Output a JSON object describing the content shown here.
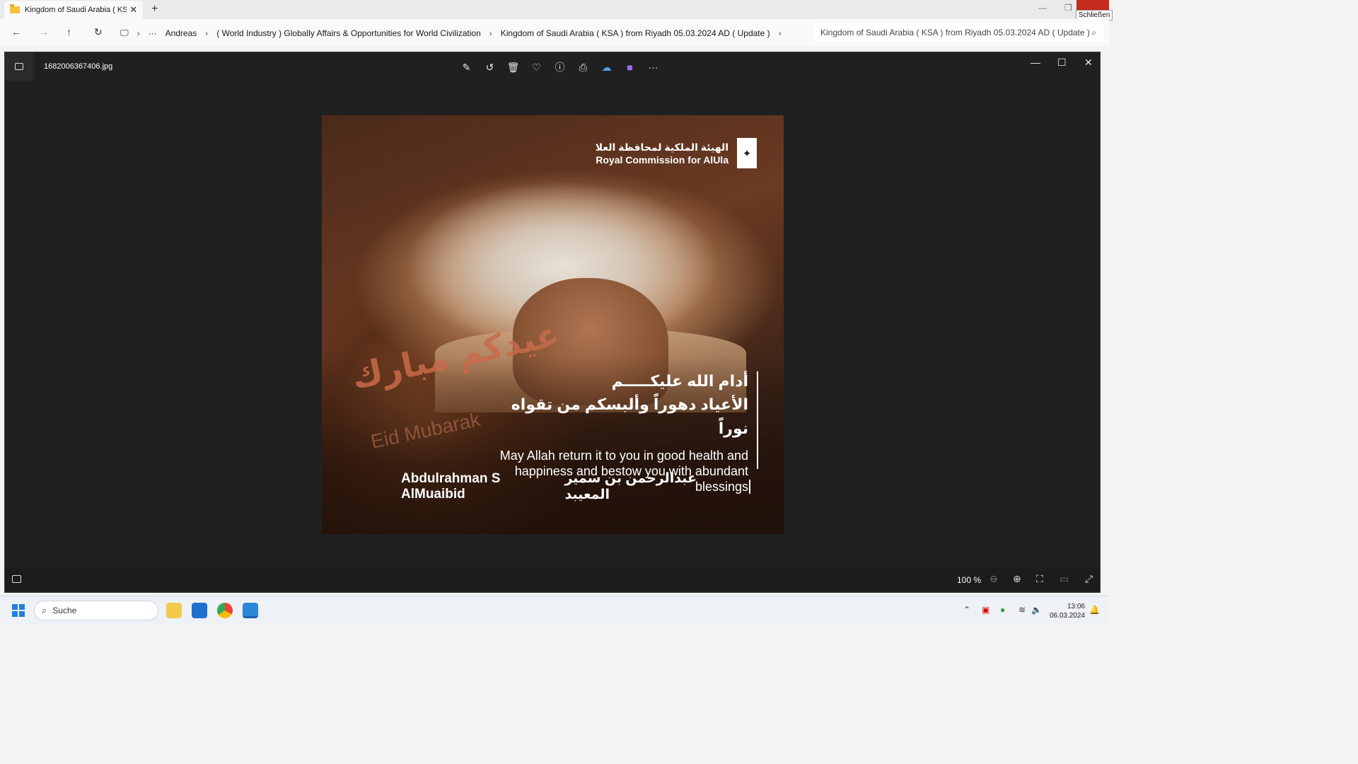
{
  "explorer": {
    "tab_title": "Kingdom of Saudi Arabia ( KSA",
    "tab_close": "✕",
    "new_tab": "+",
    "close_tooltip": "Schließen",
    "breadcrumbs": [
      "Andreas",
      "( World Industry ) Globally Affairs & Opportunities for World Civilization",
      "Kingdom of Saudi Arabia ( KSA ) from Riyadh 05.03.2024 AD ( Update )"
    ],
    "search_text": "Kingdom of Saudi Arabia ( KSA ) from Riyadh 05.03.2024 AD ( Update ) d"
  },
  "viewer": {
    "filename": "1682006367406.jpg",
    "zoom": "100 %",
    "tools": [
      "edit-icon",
      "rotate-icon",
      "delete-icon",
      "favorite-icon",
      "info-icon",
      "print-icon",
      "onedrive-icon",
      "clipchamp-icon",
      "more-icon"
    ]
  },
  "photo": {
    "commission_ar": "الهيئة الملكية لمحافظة العلا",
    "commission_en": "Royal Commission for AlUla",
    "greeting_ar_1": "أدام الله عليكـــــم",
    "greeting_ar_2": "الأعياد دهوراً وألبسكم من تقواه نوراً",
    "greeting_en": "May Allah return it to you in good health and happiness and bestow you with abundant blessings",
    "signer_en": "Abdulrahman S AlMuaibid",
    "signer_ar": "عبدالرحمن بن سمير المعيبد",
    "eid_ar": "عيدكم مبارك",
    "eid_en": "Eid Mubarak"
  },
  "taskbar": {
    "search": "Suche",
    "time": "13:06",
    "date": "06.03.2024"
  }
}
